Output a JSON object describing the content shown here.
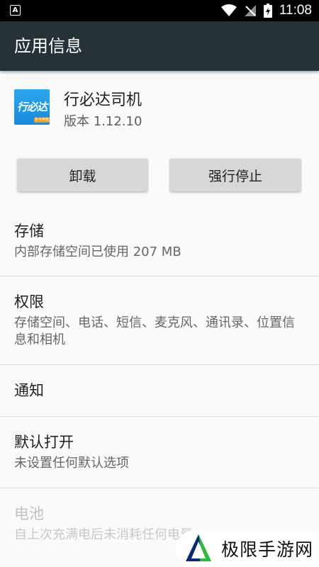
{
  "status_bar": {
    "notification_icon_letter": "A",
    "time": "11:08"
  },
  "app_bar": {
    "title": "应用信息"
  },
  "app": {
    "name": "行必达司机",
    "version": "版本 1.12.10",
    "icon_text": "行必达",
    "icon_strip_text": "永不停歇"
  },
  "buttons": {
    "uninstall": "卸载",
    "force_stop": "强行停止"
  },
  "sections": {
    "storage": {
      "title": "存储",
      "desc": "内部存储空间已使用 207 MB"
    },
    "permissions": {
      "title": "权限",
      "desc": "存储空间、电话、短信、麦克风、通讯录、位置信息和相机"
    },
    "notifications": {
      "title": "通知"
    },
    "open_by_default": {
      "title": "默认打开",
      "desc": "未设置任何默认选项"
    },
    "battery": {
      "title": "电池",
      "desc": "自上次充满电后未消耗任何电量"
    }
  },
  "watermark": {
    "text": "极限手游网"
  },
  "colors": {
    "app_bar": "#263238",
    "button": "#d6d7d7",
    "icon_blue": "#1f95e3",
    "icon_orange": "#f39a1b"
  }
}
